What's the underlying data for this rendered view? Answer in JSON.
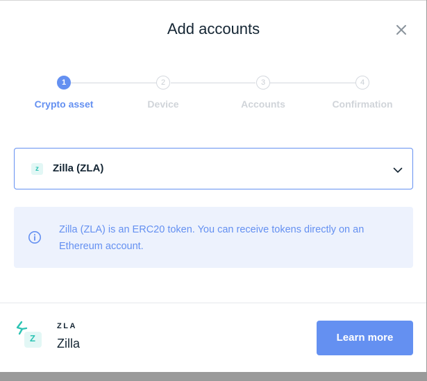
{
  "modal": {
    "title": "Add accounts",
    "close_icon": "close-icon"
  },
  "stepper": {
    "steps": [
      {
        "number": "1",
        "label": "Crypto asset",
        "active": true
      },
      {
        "number": "2",
        "label": "Device",
        "active": false
      },
      {
        "number": "3",
        "label": "Accounts",
        "active": false
      },
      {
        "number": "4",
        "label": "Confirmation",
        "active": false
      }
    ]
  },
  "asset_select": {
    "badge": "z",
    "value": "Zilla (ZLA)",
    "chevron_icon": "chevron-down-icon"
  },
  "info": {
    "icon": "info-icon",
    "text": "Zilla (ZLA) is an ERC20 token. You can receive tokens directly on an Ethereum account."
  },
  "footer": {
    "logo_badge": "Z",
    "ticker": "ZLA",
    "name": "Zilla",
    "learn_more_label": "Learn more"
  },
  "colors": {
    "accent": "#6490f1",
    "info_bg": "#edf2fd",
    "token_teal": "#2cc3b3",
    "text_dark": "#142533",
    "inactive": "#d0d4d9"
  }
}
